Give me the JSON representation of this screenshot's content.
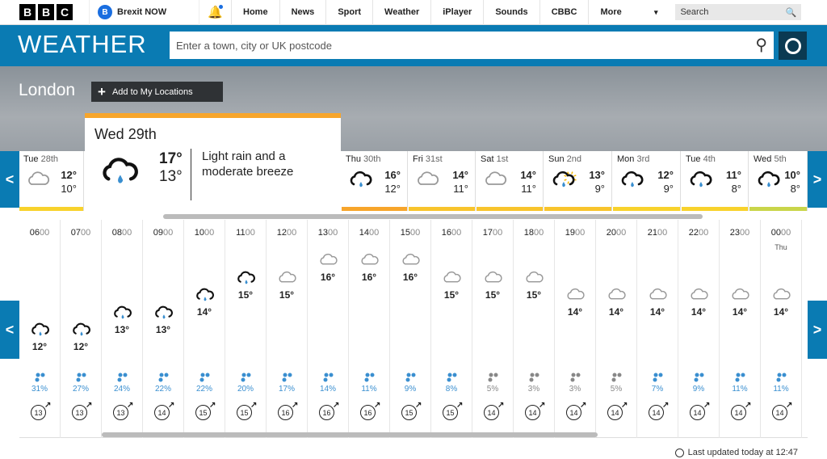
{
  "header": {
    "logo": "BBC",
    "promo": "Brexit NOW",
    "promo_badge": "B",
    "nav": [
      "Home",
      "News",
      "Sport",
      "Weather",
      "iPlayer",
      "Sounds",
      "CBBC",
      "More"
    ],
    "search_label": "Search"
  },
  "weather_bar": {
    "title": "WEATHER",
    "search_placeholder": "Enter a town, city or UK postcode"
  },
  "location": {
    "name": "London",
    "add_label": "Add to My Locations"
  },
  "selected_day": {
    "day": "Wed",
    "date": "29th",
    "high": "17°",
    "low": "13°",
    "description": "Light rain and a moderate breeze",
    "icon": "light-rain"
  },
  "days": [
    {
      "day": "Tue",
      "date": "28th",
      "high": "12°",
      "low": "10°",
      "icon": "cloud",
      "bar": "#f8d22c"
    },
    {
      "day": "Thu",
      "date": "30th",
      "high": "16°",
      "low": "12°",
      "icon": "light-rain",
      "bar": "#f7a52b"
    },
    {
      "day": "Fri",
      "date": "31st",
      "high": "14°",
      "low": "11°",
      "icon": "cloud",
      "bar": "#f8c42c"
    },
    {
      "day": "Sat",
      "date": "1st",
      "high": "14°",
      "low": "11°",
      "icon": "cloud",
      "bar": "#f8c42c"
    },
    {
      "day": "Sun",
      "date": "2nd",
      "high": "13°",
      "low": "9°",
      "icon": "sunny-rain",
      "bar": "#f8c42c"
    },
    {
      "day": "Mon",
      "date": "3rd",
      "high": "12°",
      "low": "9°",
      "icon": "light-rain",
      "bar": "#f8d22c"
    },
    {
      "day": "Tue",
      "date": "4th",
      "high": "11°",
      "low": "8°",
      "icon": "light-rain",
      "bar": "#f8d22c"
    },
    {
      "day": "Wed",
      "date": "5th",
      "high": "10°",
      "low": "8°",
      "icon": "light-rain",
      "bar": "#c9d54a"
    }
  ],
  "hourly": [
    {
      "h": "06",
      "m": "00",
      "temp": 12,
      "icon": "light-rain",
      "rain": "31%",
      "wind": "13"
    },
    {
      "h": "07",
      "m": "00",
      "temp": 12,
      "icon": "light-rain",
      "rain": "27%",
      "wind": "13"
    },
    {
      "h": "08",
      "m": "00",
      "temp": 13,
      "icon": "light-rain",
      "rain": "24%",
      "wind": "13"
    },
    {
      "h": "09",
      "m": "00",
      "temp": 13,
      "icon": "light-rain",
      "rain": "22%",
      "wind": "14"
    },
    {
      "h": "10",
      "m": "00",
      "temp": 14,
      "icon": "light-rain",
      "rain": "22%",
      "wind": "15"
    },
    {
      "h": "11",
      "m": "00",
      "temp": 15,
      "icon": "light-rain",
      "rain": "20%",
      "wind": "15"
    },
    {
      "h": "12",
      "m": "00",
      "temp": 15,
      "icon": "cloud",
      "rain": "17%",
      "wind": "16"
    },
    {
      "h": "13",
      "m": "00",
      "temp": 16,
      "icon": "cloud",
      "rain": "14%",
      "wind": "16"
    },
    {
      "h": "14",
      "m": "00",
      "temp": 16,
      "icon": "cloud",
      "rain": "11%",
      "wind": "16"
    },
    {
      "h": "15",
      "m": "00",
      "temp": 16,
      "icon": "cloud",
      "rain": "9%",
      "wind": "15"
    },
    {
      "h": "16",
      "m": "00",
      "temp": 15,
      "icon": "cloud",
      "rain": "8%",
      "wind": "15"
    },
    {
      "h": "17",
      "m": "00",
      "temp": 15,
      "icon": "cloud",
      "rain": "5%",
      "wind": "14"
    },
    {
      "h": "18",
      "m": "00",
      "temp": 15,
      "icon": "cloud",
      "rain": "3%",
      "wind": "14"
    },
    {
      "h": "19",
      "m": "00",
      "temp": 14,
      "icon": "cloud",
      "rain": "3%",
      "wind": "14"
    },
    {
      "h": "20",
      "m": "00",
      "temp": 14,
      "icon": "cloud",
      "rain": "5%",
      "wind": "14"
    },
    {
      "h": "21",
      "m": "00",
      "temp": 14,
      "icon": "cloud",
      "rain": "7%",
      "wind": "14"
    },
    {
      "h": "22",
      "m": "00",
      "temp": 14,
      "icon": "cloud",
      "rain": "9%",
      "wind": "14"
    },
    {
      "h": "23",
      "m": "00",
      "temp": 14,
      "icon": "cloud",
      "rain": "11%",
      "wind": "14"
    },
    {
      "h": "00",
      "m": "00",
      "day": "Thu",
      "temp": 14,
      "icon": "cloud",
      "rain": "11%",
      "wind": "14"
    }
  ],
  "colors": {
    "brand": "#0a7bb3",
    "rain_high": "#3a8fd0",
    "rain_low": "#888888"
  },
  "footer": {
    "updated": "Last updated today at 12:47"
  }
}
